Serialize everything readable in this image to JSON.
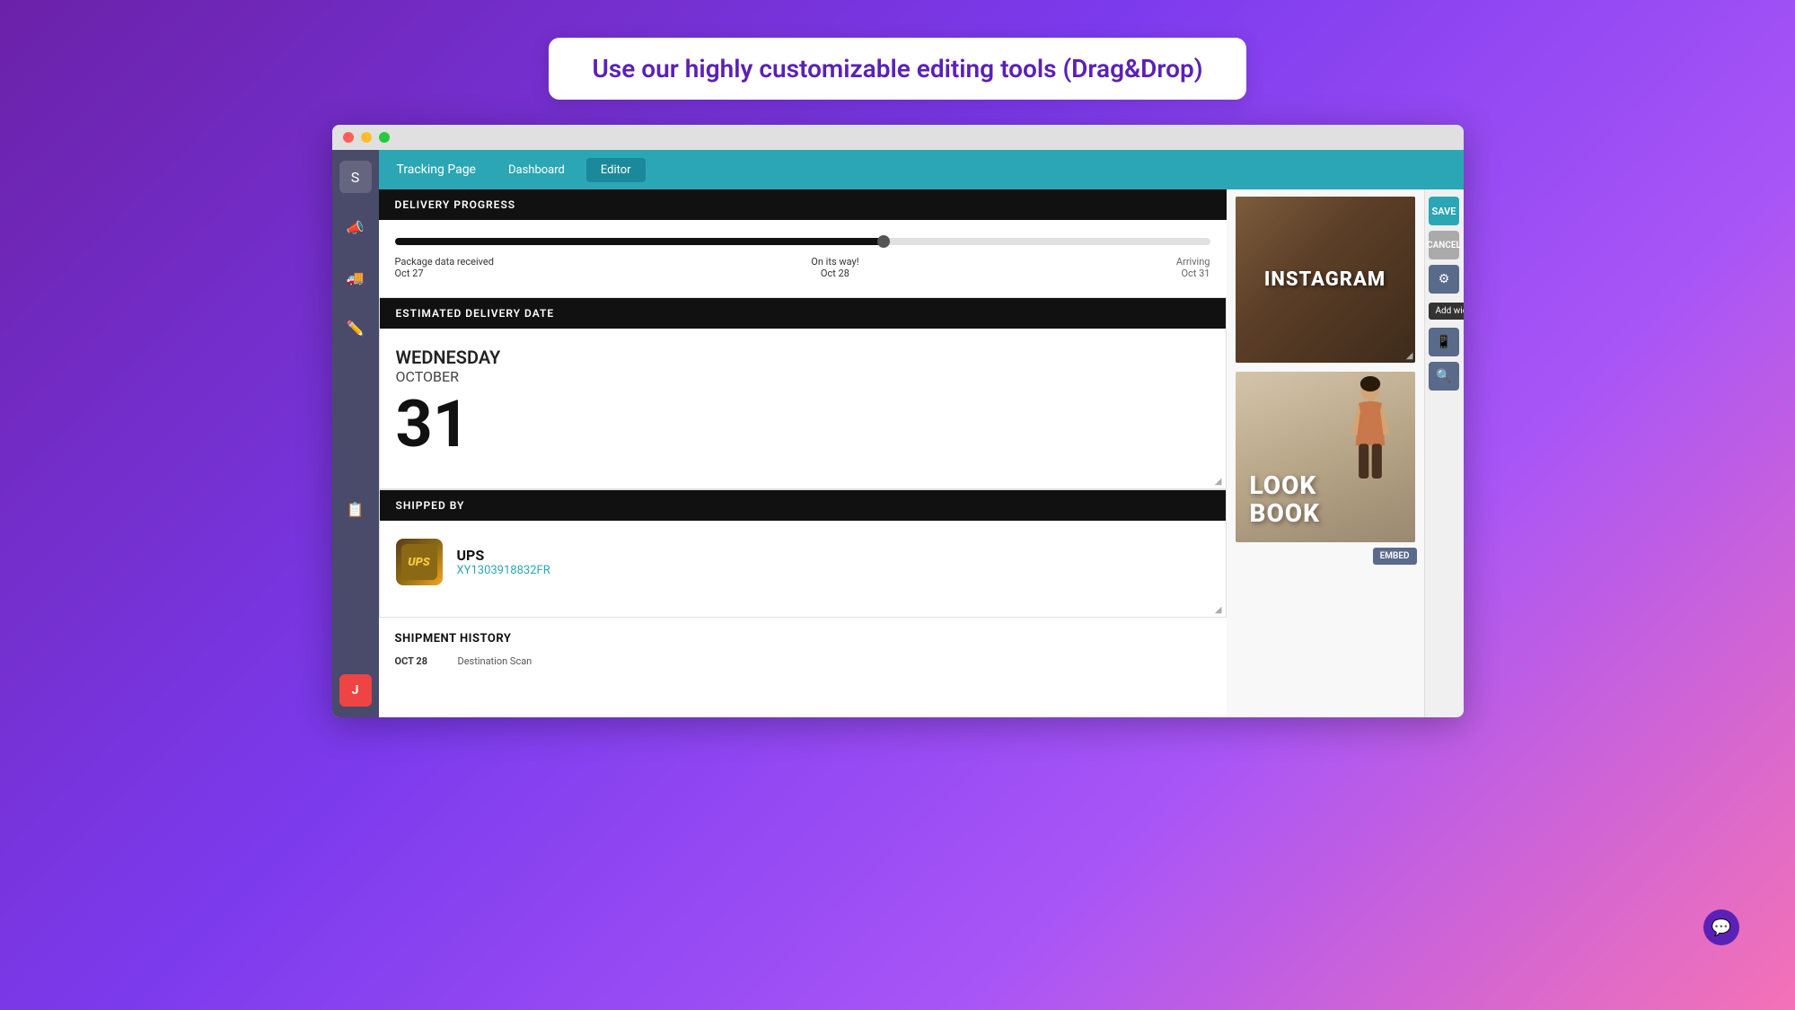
{
  "banner": {
    "text": "Use our highly customizable editing tools (Drag&Drop)"
  },
  "nav": {
    "title": "Tracking Page",
    "tabs": [
      {
        "label": "Dashboard",
        "active": false
      },
      {
        "label": "Editor",
        "active": true
      }
    ]
  },
  "toolbar": {
    "save_label": "SAVE",
    "cancel_label": "CANCEL",
    "add_widget_label": "Add widget"
  },
  "sections": {
    "delivery_progress": {
      "header": "DELIVERY PROGRESS",
      "steps": [
        {
          "label": "Package data received",
          "date": "Oct 27"
        },
        {
          "label": "On its way!",
          "date": "Oct 28"
        },
        {
          "label": "Arriving",
          "date": "Oct 31"
        }
      ],
      "progress_pct": 60
    },
    "estimated_delivery": {
      "header": "ESTIMATED DELIVERY DATE",
      "day_name": "WEDNESDAY",
      "month": "OCTOBER",
      "day_number": "31"
    },
    "shipped_by": {
      "header": "SHIPPED BY",
      "carrier": "UPS",
      "carrier_logo": "UPS",
      "tracking_number": "XY1303918832FR"
    },
    "shipment_history": {
      "title": "SHIPMENT HISTORY",
      "entries": [
        {
          "date": "OCT 28",
          "description": "Destination Scan"
        }
      ]
    }
  },
  "widgets": {
    "instagram": {
      "label": "INSTAGRAM"
    },
    "lookbook": {
      "label": "LOOK\nBOOK"
    },
    "embed_label": "EMBED"
  },
  "sidebar": {
    "icons": [
      {
        "name": "logo-icon",
        "label": "S"
      },
      {
        "name": "megaphone-icon",
        "label": "📣"
      },
      {
        "name": "truck-icon",
        "label": "🚚"
      },
      {
        "name": "edit-icon",
        "label": "✏️"
      },
      {
        "name": "documents-icon",
        "label": "📋"
      },
      {
        "name": "user-avatar",
        "label": "J"
      }
    ]
  },
  "chat": {
    "icon": "💬"
  }
}
